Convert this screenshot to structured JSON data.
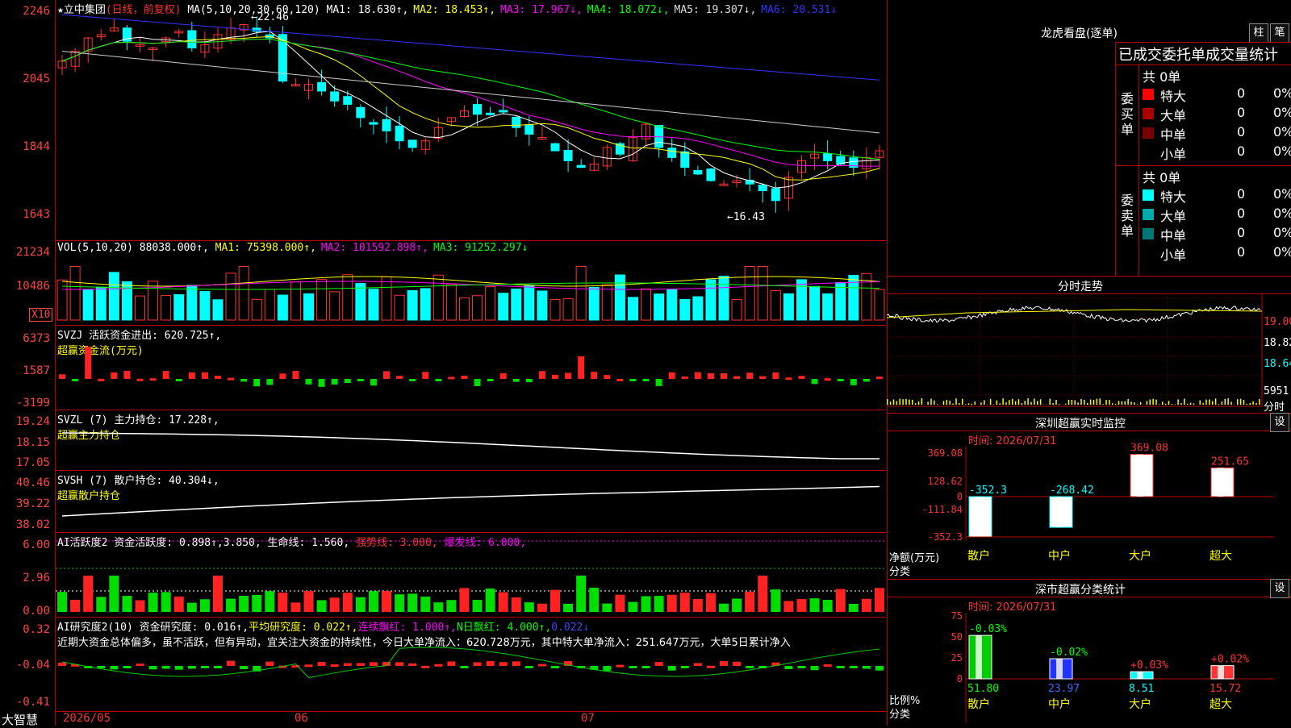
{
  "app": {
    "brand": "大智慧"
  },
  "main": {
    "star": "★",
    "stock": "立中集团",
    "period": "(日线，前复权)",
    "ma_params": "MA(5,10,20,30,60,120)",
    "ma": [
      {
        "label": "MA1: 18.630↑,",
        "color": "#ffffff"
      },
      {
        "label": "MA2: 18.453↑,",
        "color": "#ffff00"
      },
      {
        "label": "MA3: 17.967↓,",
        "color": "#ff00ff"
      },
      {
        "label": "MA4: 18.072↓,",
        "color": "#00ff00"
      },
      {
        "label": "MA5: 19.307↓,",
        "color": "#dddddd"
      },
      {
        "label": "MA6: 20.531↓",
        "color": "#3333ff"
      }
    ],
    "high_mark": "22.46",
    "low_mark": "16.43",
    "y_labels": [
      "2246",
      "2045",
      "1844",
      "1643"
    ]
  },
  "vol": {
    "name": "VOL(5,10,20)",
    "value": "88038.000↑,",
    "ma": [
      {
        "label": "MA1: 75398.000↑,",
        "color": "#ffff00"
      },
      {
        "label": "MA2: 101592.898↑,",
        "color": "#ff00ff"
      },
      {
        "label": "MA3: 91252.297↓",
        "color": "#00ff00"
      }
    ],
    "y_labels": [
      "21234",
      "10486"
    ],
    "unit": "X10"
  },
  "svzj": {
    "title": "SVZJ  活跃资金进出: 620.725↑,",
    "sub": "超赢资金流(万元)",
    "y_labels": [
      "6373",
      "1587",
      "-3199"
    ]
  },
  "svzl": {
    "title": "SVZL (7) 主力持仓: 17.228↑,",
    "sub": "超赢主力持仓",
    "y_labels": [
      "19.24",
      "18.15",
      "17.05"
    ]
  },
  "svsh": {
    "title": "SVSH (7) 散户持仓: 40.304↓,",
    "sub": "超赢散户持仓",
    "y_labels": [
      "40.46",
      "39.22",
      "38.02"
    ]
  },
  "ai1": {
    "title": "AI活跃度2 资金活跃度: 0.898↑,3.850, 生命线: 1.560,",
    "strong": "强势线: 3.000,",
    "burst": "爆发线: 6.000,",
    "y_labels": [
      "6.00",
      "2.96",
      "0.00"
    ]
  },
  "ai2": {
    "t1": "AI研究度2(10) 资金研究度: 0.016↑,",
    "t2": "平均研究度: 0.022↑,",
    "t3": "连续飘红: 1.000↑,",
    "t4": "N日飘红: 4.000↑,",
    "t5": "0.022↓",
    "comment": "近期大资金总体偏多，虽不活跃，但有异动，宜关注大资金的持续性，今日大单净流入：620.728万元，其中特大单净流入：251.647万元，大单5日累计净入",
    "y_labels": [
      "0.32",
      "-0.04",
      "-0.41"
    ]
  },
  "xaxis": {
    "labels": [
      "2026/05",
      "06",
      "07"
    ]
  },
  "lhb": {
    "title": "龙虎看盘(逐单)",
    "btn_bar": "柱",
    "btn_pen": "笔",
    "header": "已成交委托单成交量统计",
    "buy_label": "委买单",
    "sell_label": "委卖单",
    "buy_total": "共 0单",
    "sell_total": "共 0单",
    "buy_rows": [
      {
        "name": "特大",
        "count": "0",
        "pct": "0%",
        "color": "#ff0000"
      },
      {
        "name": "大单",
        "count": "0",
        "pct": "0%",
        "color": "#aa0000"
      },
      {
        "name": "中单",
        "count": "0",
        "pct": "0%",
        "color": "#770000"
      },
      {
        "name": "小单",
        "count": "0",
        "pct": "0%",
        "color": "#000000"
      }
    ],
    "sell_rows": [
      {
        "name": "特大",
        "count": "0",
        "pct": "0%",
        "color": "#00ffff"
      },
      {
        "name": "大单",
        "count": "0",
        "pct": "0%",
        "color": "#00aaaa"
      },
      {
        "name": "中单",
        "count": "0",
        "pct": "0%",
        "color": "#007777"
      },
      {
        "name": "小单",
        "count": "0",
        "pct": "0%",
        "color": "#000000"
      }
    ]
  },
  "fenshi": {
    "title": "分时走势",
    "y_labels": [
      "19.00",
      "18.82",
      "18.64"
    ],
    "vol_label": "5951",
    "vol_unit": "分时"
  },
  "monitor": {
    "title": "深圳超赢实时监控",
    "settings": "设",
    "time": "时间: 2026/07/31",
    "y_labels": [
      "369.08",
      "128.62",
      "0",
      "-111.84",
      "-352.3"
    ],
    "axis_name": "净额(万元)",
    "axis_cat": "分类",
    "chart_data": {
      "type": "bar",
      "categories": [
        "散户",
        "中户",
        "大户",
        "超大"
      ],
      "values": [
        -352.3,
        -268.42,
        369.08,
        251.65
      ],
      "value_labels": [
        "-352.3",
        "-268.42",
        "369.08",
        "251.65"
      ],
      "ylim": [
        -352.3,
        369.08
      ]
    }
  },
  "classify": {
    "title": "深市超赢分类统计",
    "settings": "设",
    "time": "时间: 2026/07/31",
    "y_labels": [
      "75",
      "50",
      "25",
      "0"
    ],
    "axis_name": "比例%",
    "axis_cat": "分类",
    "chart_data": {
      "type": "bar",
      "categories": [
        "散户",
        "中户",
        "大户",
        "超大"
      ],
      "values": [
        51.8,
        23.97,
        8.51,
        15.72
      ],
      "value_labels": [
        "51.80",
        "23.97",
        "8.51",
        "15.72"
      ],
      "change_labels": [
        "-0.03%",
        "-0.02%",
        "+0.03%",
        "+0.02%"
      ],
      "ylim": [
        0,
        75
      ]
    }
  }
}
